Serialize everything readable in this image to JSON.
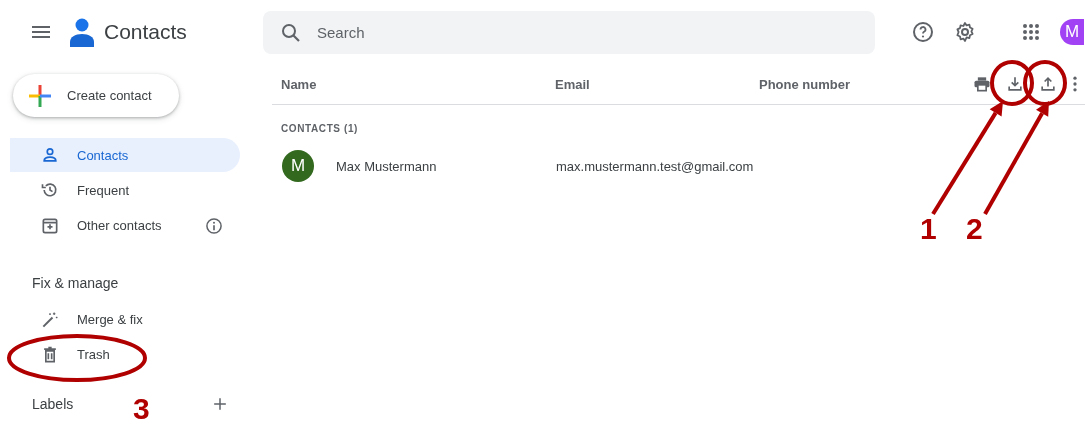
{
  "app": {
    "title": "Contacts"
  },
  "search": {
    "placeholder": "Search"
  },
  "account": {
    "initial": "M"
  },
  "create_button": "Create contact",
  "sidebar": {
    "items": [
      {
        "label": "Contacts",
        "kind": "person",
        "selected": true
      },
      {
        "label": "Frequent",
        "kind": "history",
        "selected": false
      },
      {
        "label": "Other contacts",
        "kind": "archive",
        "selected": false,
        "info": true
      }
    ],
    "section": "Fix & manage",
    "manage_items": [
      {
        "label": "Merge & fix",
        "kind": "wand"
      },
      {
        "label": "Trash",
        "kind": "trash"
      }
    ],
    "labels_heading": "Labels"
  },
  "table": {
    "columns": [
      "Name",
      "Email",
      "Phone number"
    ],
    "group": "CONTACTS (1)",
    "rows": [
      {
        "initial": "M",
        "name": "Max Mustermann",
        "email": "max.mustermann.test@gmail.com"
      }
    ]
  },
  "annotations": [
    {
      "number": "1",
      "kind": "arrow"
    },
    {
      "number": "2",
      "kind": "arrow"
    },
    {
      "number": "3",
      "kind": "circle"
    }
  ]
}
